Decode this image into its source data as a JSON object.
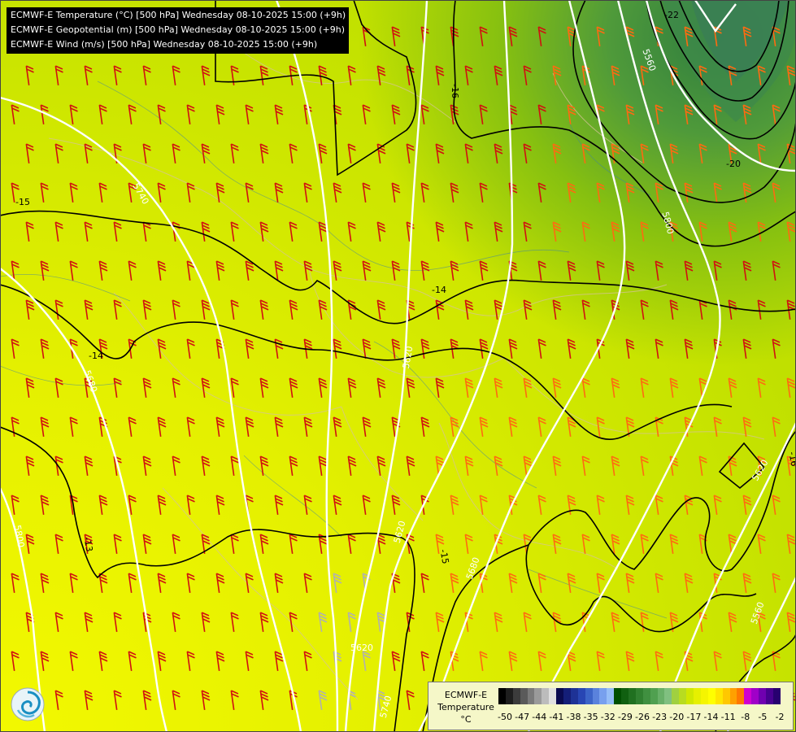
{
  "legend": {
    "lines": [
      "ECMWF-E Temperature (°C) [500 hPa] Wednesday 08-10-2025 15:00 (+9h)",
      "ECMWF-E Geopotential (m) [500 hPa] Wednesday 08-10-2025 15:00 (+9h)",
      "ECMWF-E Wind (m/s) [500 hPa] Wednesday 08-10-2025 15:00 (+9h)"
    ]
  },
  "colorbar": {
    "title_line1": "ECMWF-E",
    "title_line2": "Temperature",
    "unit": "°C",
    "tick_labels": [
      "-50",
      "-47",
      "-44",
      "-41",
      "-38",
      "-35",
      "-32",
      "-29",
      "-26",
      "-23",
      "-20",
      "-17",
      "-14",
      "-11",
      "-8",
      "-5",
      "-2"
    ],
    "colors": [
      "#000000",
      "#1e1e1e",
      "#3c3c3c",
      "#5a5a5a",
      "#7a7a7a",
      "#9a9a9a",
      "#bcbcbc",
      "#e0e0e0",
      "#0a0a50",
      "#141e78",
      "#1e3296",
      "#2846b4",
      "#3c64c8",
      "#5a82dc",
      "#78a0ee",
      "#96bef8",
      "#005000",
      "#106010",
      "#207020",
      "#308030",
      "#409040",
      "#50a050",
      "#68b068",
      "#80c080",
      "#a0d040",
      "#b8dc20",
      "#d0e800",
      "#e6f000",
      "#f5f500",
      "#ffff00",
      "#ffe600",
      "#ffc800",
      "#ffa000",
      "#ff7800",
      "#d000d0",
      "#a000c8",
      "#7000b0",
      "#480090",
      "#280070"
    ]
  },
  "contours": {
    "geopotential_labels": [
      "5740",
      "5680",
      "5800",
      "5620",
      "5620",
      "5560",
      "5800",
      "5740",
      "5680",
      "5620",
      "5560",
      "5620"
    ],
    "temperature_labels": [
      "-15",
      "-14",
      "-13",
      "-16",
      "-15",
      "-16",
      "-22",
      "-20",
      "-14"
    ]
  },
  "colors": {
    "background": "#c8e600",
    "geopotential_line": "#ffffff",
    "temperature_line": "#000000",
    "wind_barb_primary": "#d01010",
    "wind_barb_strong": "#ff6a10",
    "wind_barb_weak": "#b0b0b0"
  },
  "icons": {
    "logo": "ecmwf-swirl-icon"
  }
}
